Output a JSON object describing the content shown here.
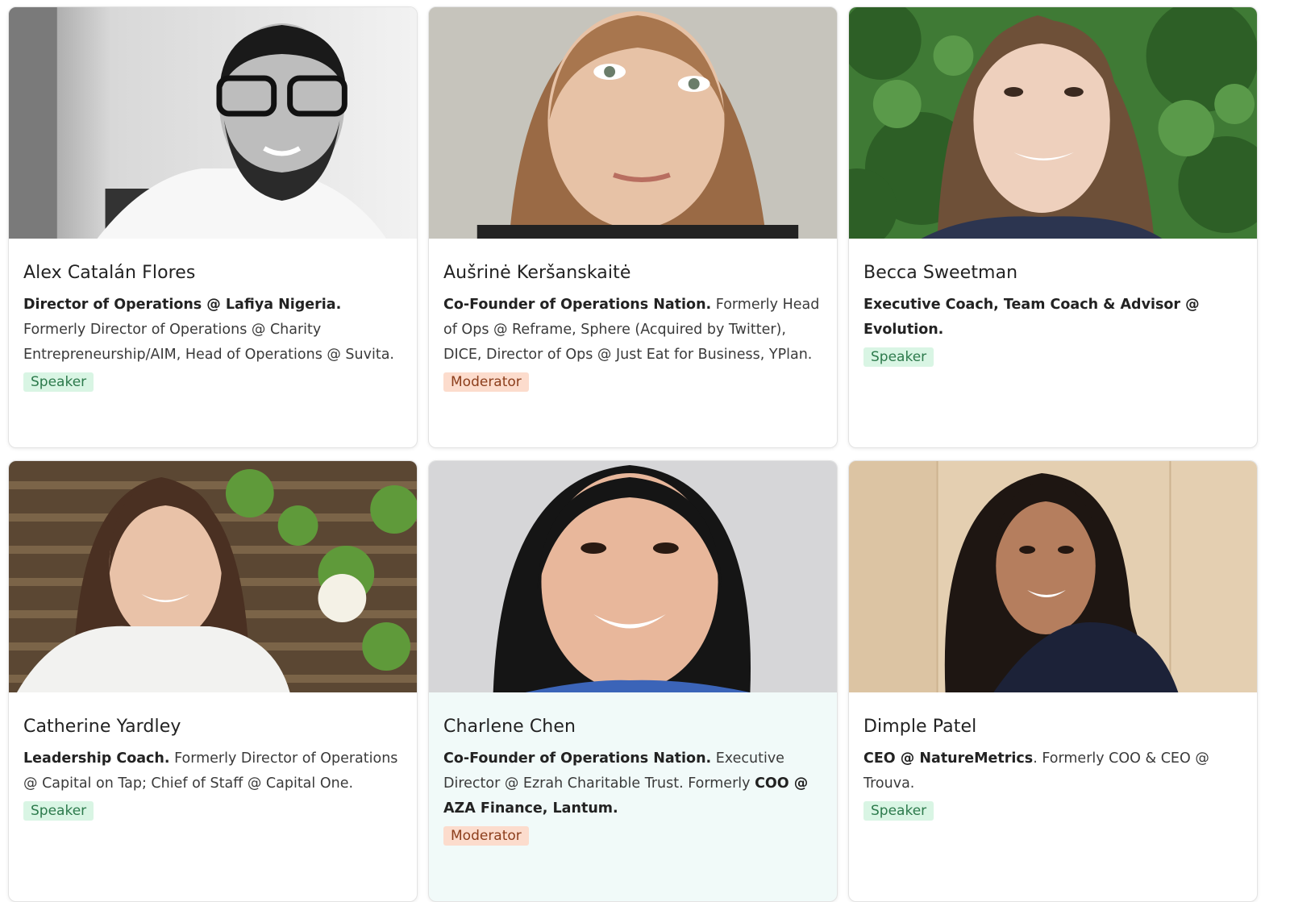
{
  "speakers": [
    {
      "name": "Alex Catalán Flores",
      "bio_bold": "Director of Operations @ Lafiya Nigeria.",
      "bio_rest": " Formerly Director of Operations @ Charity Entrepreneurship/AIM, Head of Operations @ Suvita.",
      "bio_bold2": "",
      "role": "Speaker"
    },
    {
      "name": "Aušrinė Keršanskaitė",
      "bio_bold": "Co-Founder of Operations Nation.",
      "bio_rest": " Formerly Head of Ops @ Reframe, Sphere (Acquired by Twitter), DICE, Director of Ops @ Just Eat for Business, YPlan.",
      "bio_bold2": "",
      "role": "Moderator"
    },
    {
      "name": "Becca Sweetman",
      "bio_bold": "Executive Coach, Team Coach & Advisor @ Evolution.",
      "bio_rest": "",
      "bio_bold2": "",
      "role": "Speaker"
    },
    {
      "name": "Catherine Yardley",
      "bio_bold": "Leadership Coach.",
      "bio_rest": " Formerly Director of Operations @ Capital on Tap; Chief of Staff @ Capital One.",
      "bio_bold2": "",
      "role": "Speaker"
    },
    {
      "name": "Charlene Chen",
      "bio_bold": "Co-Founder of Operations Nation.",
      "bio_rest": " Executive Director @ Ezrah Charitable Trust. Formerly ",
      "bio_bold2": "COO @ AZA Finance, Lantum.",
      "role": "Moderator"
    },
    {
      "name": "Dimple Patel",
      "bio_bold": "CEO @ NatureMetrics",
      "bio_rest": ". Formerly COO & CEO @ Trouva.",
      "bio_bold2": "",
      "role": "Speaker"
    }
  ],
  "colors": {
    "speaker_badge_bg": "#d9f5e4",
    "moderator_badge_bg": "#fcdccd",
    "highlight_card_bg": "#f1faf9"
  }
}
